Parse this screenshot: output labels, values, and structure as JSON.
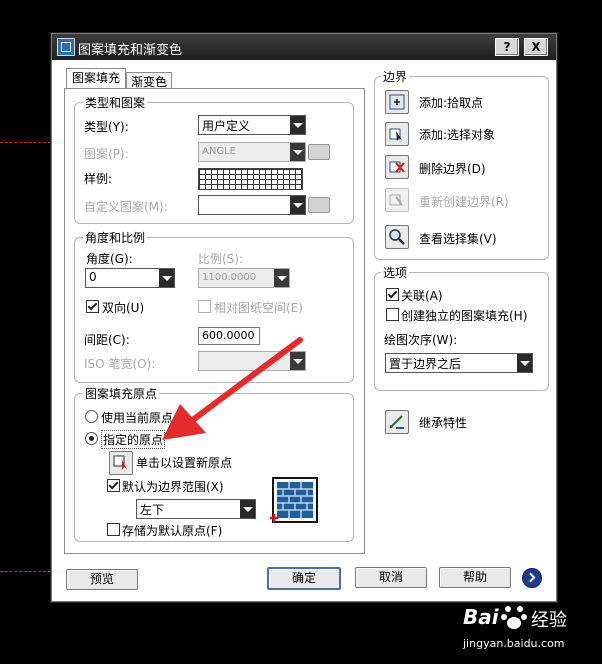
{
  "dialog": {
    "title": "图案填充和渐变色",
    "title_buttons": [
      "?",
      "X"
    ]
  },
  "tabs": [
    {
      "label": "图案填充",
      "active": true
    },
    {
      "label": "渐变色",
      "active": false
    }
  ],
  "type_pattern": {
    "title": "类型和图案",
    "type_label": "类型(Y):",
    "type_value": "用户定义",
    "pattern_label": "图案(P):",
    "pattern_value": "ANGLE",
    "swatch_label": "样例:",
    "custom_label": "自定义图案(M):",
    "custom_value": ""
  },
  "angle_scale": {
    "title": "角度和比例",
    "angle_label": "角度(G):",
    "angle_value": "0",
    "scale_label": "比例(S):",
    "scale_value": "1100.0000",
    "double_label": "双向(U)",
    "double_checked": true,
    "relative_label": "相对图纸空间(E)",
    "relative_checked": false,
    "spacing_label": "间距(C):",
    "spacing_value": "600.0000",
    "iso_label": "ISO 笔宽(O):",
    "iso_value": ""
  },
  "origin": {
    "title": "图案填充原点",
    "use_current_label": "使用当前原点(T)",
    "specified_label": "指定的原点",
    "click_set_label": "单击以设置新原点",
    "default_extents_label": "默认为边界范围(X)",
    "default_extents_checked": true,
    "extents_value": "左下",
    "store_default_label": "存储为默认原点(F)",
    "store_default_checked": false
  },
  "boundaries": {
    "title": "边界",
    "add_pick_label": "添加:拾取点",
    "add_select_label": "添加:选择对象",
    "remove_label": "删除边界(D)",
    "recreate_label": "重新创建边界(R)",
    "view_selection_label": "查看选择集(V)"
  },
  "options": {
    "title": "选项",
    "associative_label": "关联(A)",
    "associative_checked": true,
    "independent_label": "创建独立的图案填充(H)",
    "independent_checked": false,
    "draw_order_label": "绘图次序(W):",
    "draw_order_value": "置于边界之后"
  },
  "inherit_label": "继承特性",
  "footer": {
    "preview": "预览",
    "ok": "确定",
    "cancel": "取消",
    "help": "帮助"
  },
  "watermark": {
    "brand": "Bai",
    "brand_suffix": "经验",
    "url": "jingyan.baidu.com"
  },
  "colors": {
    "annotation_arrow": "#e32b2b",
    "titlebar": "#2a2a2a",
    "help_circle": "#1d3b8f"
  }
}
